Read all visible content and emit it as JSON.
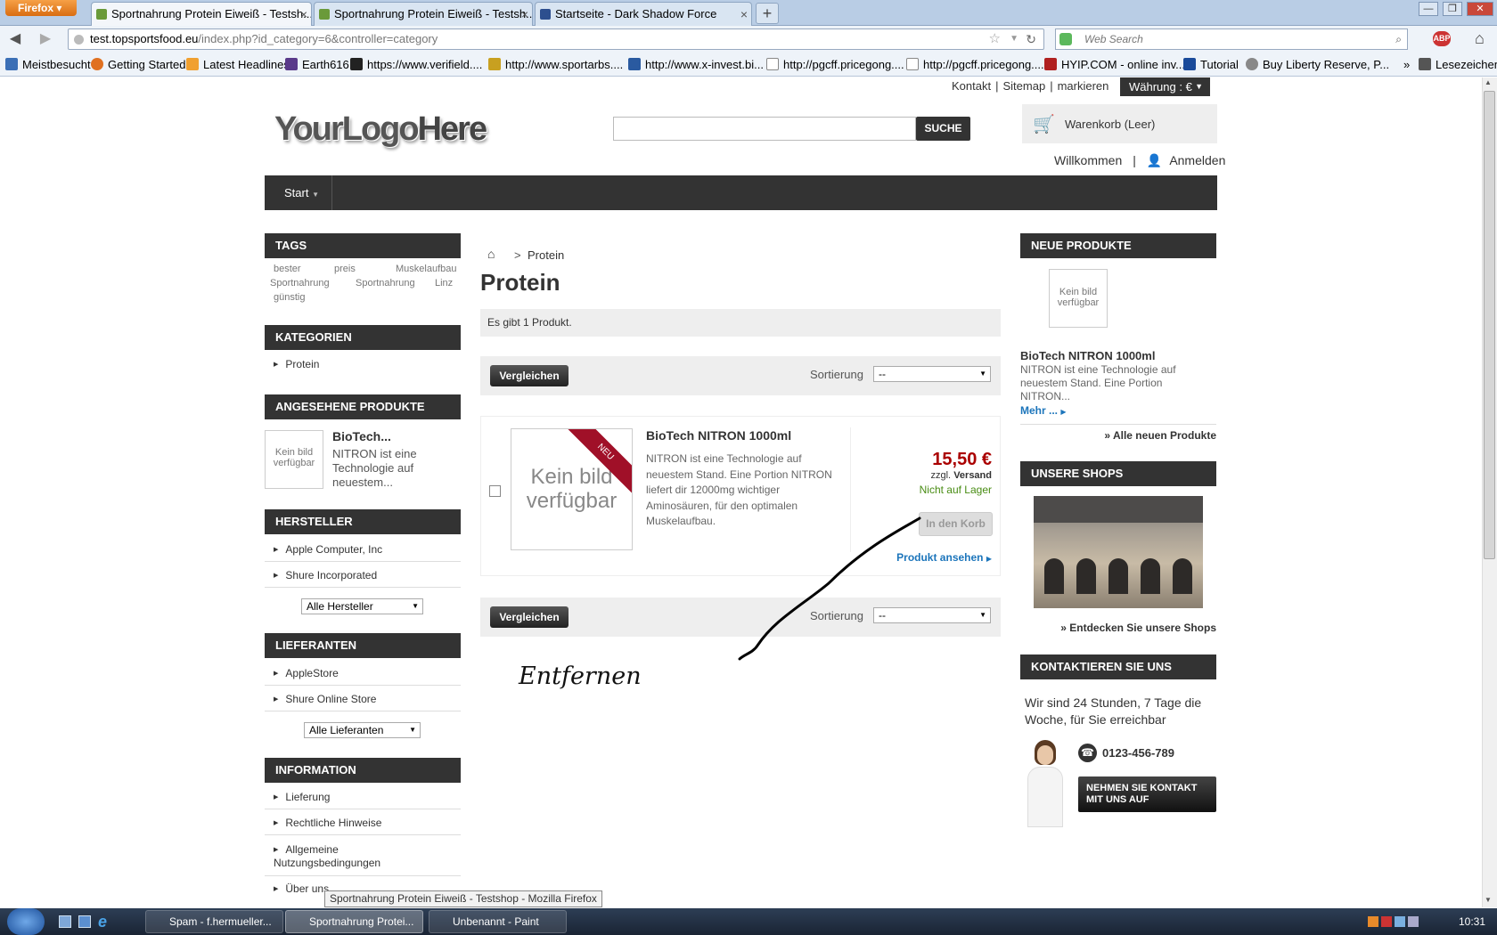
{
  "browser": {
    "app_button": "Firefox",
    "tabs": [
      {
        "label": "Sportnahrung Protein Eiweiß - Testsh..."
      },
      {
        "label": "Sportnahrung Protein Eiweiß - Testsh..."
      },
      {
        "label": "Startseite - Dark Shadow Force"
      }
    ],
    "url_domain": "test.topsportsfood.eu",
    "url_path": "/index.php?id_category=6&controller=category",
    "search_placeholder": "Web Search",
    "bookmarks": [
      "Meistbesucht",
      "Getting Started",
      "Latest Headlines",
      "Earth616",
      "https://www.verifield....",
      "http://www.sportarbs....",
      "http://www.x-invest.bi...",
      "http://pgcff.pricegong....",
      "http://pgcff.pricegong....",
      "HYIP.COM - online inv...",
      "Tutorial",
      "Buy Liberty Reserve, P..."
    ],
    "bookmarks_folder": "Lesezeichen"
  },
  "shop": {
    "toplinks": [
      "Kontakt",
      "Sitemap",
      "markieren"
    ],
    "currency": "Währung : €",
    "logo_your": "YourLogo",
    "logo_here": "Here",
    "search_button": "SUCHE",
    "cart_label": "Warenkorb (Leer)",
    "welcome": "Willkommen",
    "login": "Anmelden",
    "menu_start": "Start"
  },
  "left": {
    "tags_title": "TAGS",
    "tags": [
      "bester",
      "preis",
      "Muskelaufbau",
      "Sportnahrung",
      "Sportnahrung",
      "Linz",
      "günstig"
    ],
    "categories_title": "KATEGORIEN",
    "categories": [
      "Protein"
    ],
    "viewed_title": "ANGESEHENE PRODUKTE",
    "viewed_name": "BioTech...",
    "viewed_desc": "NITRON ist eine Technologie auf neuestem...",
    "noimg": "Kein bild verfügbar",
    "manufacturers_title": "HERSTELLER",
    "manufacturers": [
      "Apple Computer, Inc",
      "Shure Incorporated"
    ],
    "manufacturers_select": "Alle Hersteller",
    "suppliers_title": "LIEFERANTEN",
    "suppliers": [
      "AppleStore",
      "Shure Online Store"
    ],
    "suppliers_select": "Alle Lieferanten",
    "info_title": "INFORMATION",
    "info": [
      "Lieferung",
      "Rechtliche Hinweise",
      "Allgemeine Nutzungsbedingungen",
      "Über uns"
    ]
  },
  "center": {
    "breadcrumb_sep": ">",
    "breadcrumb": "Protein",
    "title": "Protein",
    "count": "Es gibt 1 Produkt.",
    "compare": "Vergleichen",
    "sort_label": "Sortierung",
    "sort_value": "--",
    "product": {
      "name": "BioTech NITRON 1000ml",
      "desc": "NITRON ist eine Technologie auf neuestem Stand. Eine Portion NITRON liefert dir 12000mg wichtiger Aminosäuren, für den optimalen Muskelaufbau.",
      "badge": "NEU",
      "noimg": "Kein bild verfügbar",
      "price": "15,50 €",
      "shipping_prefix": "zzgl.",
      "shipping": "Versand",
      "stock": "Nicht auf Lager",
      "add_to_cart": "In den Korb",
      "view": "Produkt ansehen"
    },
    "annotation": "Entfernen"
  },
  "right": {
    "new_title": "NEUE PRODUKTE",
    "new_noimg": "Kein bild verfügbar",
    "new_name": "BioTech NITRON 1000ml",
    "new_desc": "NITRON ist eine Technologie auf neuestem Stand. Eine Portion NITRON...",
    "more": "Mehr ...",
    "all_new": "» Alle neuen Produkte",
    "shops_title": "UNSERE SHOPS",
    "shops_link": "» Entdecken Sie unsere Shops",
    "contact_title": "KONTAKTIEREN SIE UNS",
    "contact_text": "Wir sind 24 Stunden, 7 Tage die Woche, für Sie erreichbar",
    "phone": "0123-456-789",
    "contact_button": "NEHMEN SIE KONTAKT MIT UNS AUF"
  },
  "statusbar": {
    "tooltip": "Sportnahrung Protein Eiweiß - Testshop - Mozilla Firefox"
  },
  "taskbar": {
    "items": [
      "Spam - f.hermueller...",
      "Sportnahrung Protei...",
      "Unbenannt - Paint"
    ],
    "clock": "10:31"
  }
}
